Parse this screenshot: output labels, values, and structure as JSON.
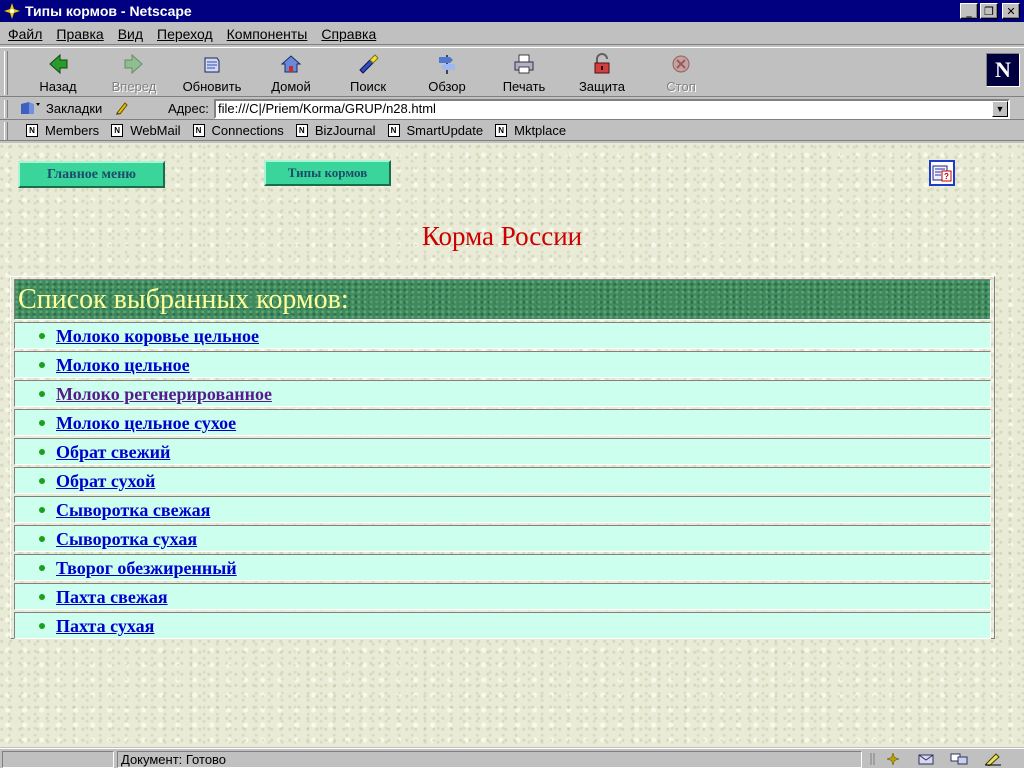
{
  "window": {
    "title": "Типы кормов - Netscape",
    "minimize": "_",
    "restore": "❐",
    "close": "✕"
  },
  "menu": [
    "Файл",
    "Правка",
    "Вид",
    "Переход",
    "Компоненты",
    "Справка"
  ],
  "toolbar": {
    "back": "Назад",
    "forward": "Вперед",
    "reload": "Обновить",
    "home": "Домой",
    "search": "Поиск",
    "guide": "Обзор",
    "print": "Печать",
    "security": "Защита",
    "stop": "Стоп",
    "logo": "N"
  },
  "location": {
    "bookmarks": "Закладки",
    "address_label": "Адрес:",
    "url": "file:///C|/Priem/Korma/GRUP/n28.html"
  },
  "personal": [
    "Members",
    "WebMail",
    "Connections",
    "BizJournal",
    "SmartUpdate",
    "Mktplace"
  ],
  "page": {
    "main_menu_button": "Главное меню",
    "feed_types_button": "Типы кормов",
    "title": "Корма России",
    "list_header": "Список выбранных кормов:",
    "items": [
      "Молоко коровье цельное",
      "Молоко цельное",
      "Молоко регенерированное",
      "Молоко цельное сухое",
      "Обрат свежий",
      "Обрат сухой",
      "Сыворотка свежая",
      "Сыворотка сухая",
      "Творог обезжиренный",
      "Пахта свежая",
      "Пахта сухая"
    ],
    "visited_index": 2
  },
  "status": {
    "text": "Документ: Готово"
  }
}
